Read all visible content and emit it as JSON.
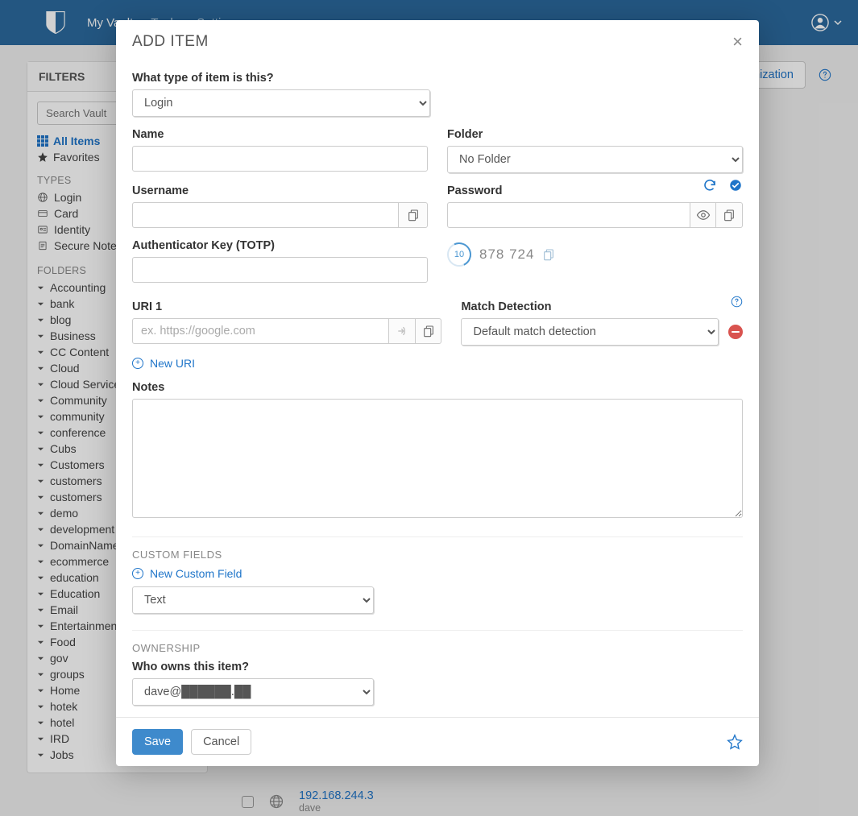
{
  "nav": {
    "items": [
      "My Vault",
      "Tools",
      "Settings"
    ],
    "active_index": 0
  },
  "filters": {
    "header": "FILTERS",
    "search_placeholder": "Search Vault",
    "all_items": "All Items",
    "favorites": "Favorites",
    "types_label": "TYPES",
    "types": [
      {
        "name": "Login",
        "icon": "globe"
      },
      {
        "name": "Card",
        "icon": "card"
      },
      {
        "name": "Identity",
        "icon": "id"
      },
      {
        "name": "Secure Note",
        "icon": "note"
      }
    ],
    "folders_label": "FOLDERS",
    "folders": [
      "Accounting",
      "bank",
      "blog",
      "Business",
      "CC Content",
      "Cloud",
      "Cloud Services",
      "Community",
      "community",
      "conference",
      "Cubs",
      "Customers",
      "customers",
      "customers",
      "demo",
      "development",
      "DomainNames",
      "ecommerce",
      "education",
      "Education",
      "Email",
      "Entertainment",
      "Food",
      "gov",
      "groups",
      "Home",
      "hotek",
      "hotel",
      "IRD",
      "Jobs"
    ]
  },
  "right": {
    "org_button": "+ New Organization"
  },
  "vault_row": {
    "title": "192.168.244.3",
    "subtitle": "dave"
  },
  "modal": {
    "title": "ADD ITEM",
    "type_label": "What type of item is this?",
    "type_value": "Login",
    "name_label": "Name",
    "folder_label": "Folder",
    "folder_value": "No Folder",
    "username_label": "Username",
    "password_label": "Password",
    "totp_label": "Authenticator Key (TOTP)",
    "totp_timer": "10",
    "totp_code": "878  724",
    "uri1_label": "URI 1",
    "uri1_placeholder": "ex. https://google.com",
    "match_label": "Match Detection",
    "match_value": "Default match detection",
    "new_uri": "New URI",
    "notes_label": "Notes",
    "custom_fields_label": "CUSTOM FIELDS",
    "new_custom_field": "New Custom Field",
    "custom_field_type": "Text",
    "ownership_label": "OWNERSHIP",
    "owner_label": "Who owns this item?",
    "owner_value": "dave@██████.██",
    "save": "Save",
    "cancel": "Cancel"
  }
}
